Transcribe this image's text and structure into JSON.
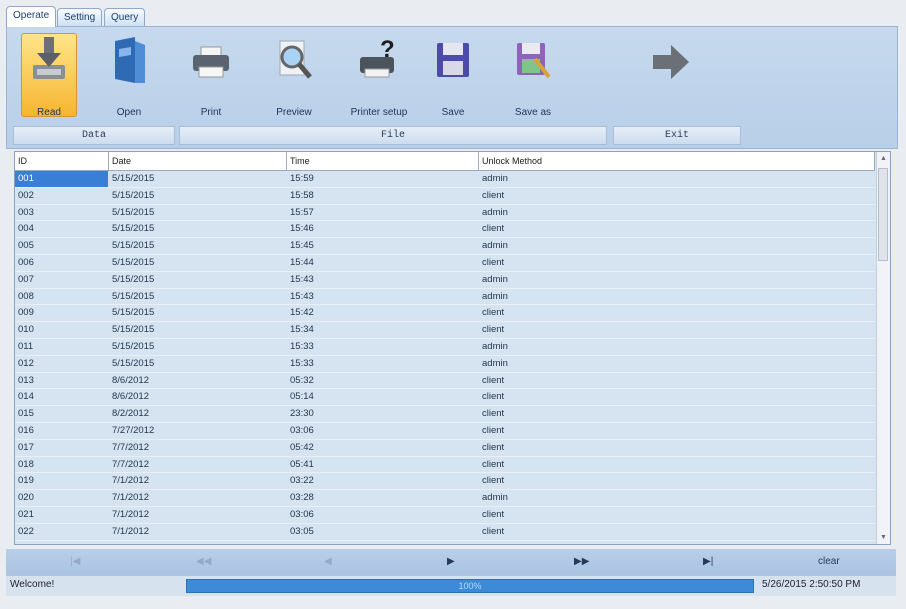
{
  "tabs": [
    "Operate",
    "Setting",
    "Query"
  ],
  "toolbar": {
    "buttons": [
      {
        "label": "Read",
        "icon": "download-icon"
      },
      {
        "label": "Open",
        "icon": "folder-open-icon"
      },
      {
        "label": "Print",
        "icon": "printer-icon"
      },
      {
        "label": "Preview",
        "icon": "magnifier-icon"
      },
      {
        "label": "Printer setup",
        "icon": "printer-setup-icon"
      },
      {
        "label": "Save",
        "icon": "floppy-icon"
      },
      {
        "label": "Save as",
        "icon": "save-as-icon"
      },
      {
        "label": "",
        "icon": "exit-arrow-icon"
      }
    ],
    "groups": [
      "Data",
      "File",
      "Exit"
    ]
  },
  "table": {
    "columns": [
      "ID",
      "Date",
      "Time",
      "Unlock Method"
    ],
    "rows": [
      [
        "001",
        "5/15/2015",
        "15:59",
        "admin"
      ],
      [
        "002",
        "5/15/2015",
        "15:58",
        "client"
      ],
      [
        "003",
        "5/15/2015",
        "15:57",
        "admin"
      ],
      [
        "004",
        "5/15/2015",
        "15:46",
        "client"
      ],
      [
        "005",
        "5/15/2015",
        "15:45",
        "admin"
      ],
      [
        "006",
        "5/15/2015",
        "15:44",
        "client"
      ],
      [
        "007",
        "5/15/2015",
        "15:43",
        "admin"
      ],
      [
        "008",
        "5/15/2015",
        "15:43",
        "admin"
      ],
      [
        "009",
        "5/15/2015",
        "15:42",
        "client"
      ],
      [
        "010",
        "5/15/2015",
        "15:34",
        "client"
      ],
      [
        "011",
        "5/15/2015",
        "15:33",
        "admin"
      ],
      [
        "012",
        "5/15/2015",
        "15:33",
        "admin"
      ],
      [
        "013",
        "8/6/2012",
        "05:32",
        "client"
      ],
      [
        "014",
        "8/6/2012",
        "05:14",
        "client"
      ],
      [
        "015",
        "8/2/2012",
        "23:30",
        "client"
      ],
      [
        "016",
        "7/27/2012",
        "03:06",
        "client"
      ],
      [
        "017",
        "7/7/2012",
        "05:42",
        "client"
      ],
      [
        "018",
        "7/7/2012",
        "05:41",
        "client"
      ],
      [
        "019",
        "7/1/2012",
        "03:22",
        "client"
      ],
      [
        "020",
        "7/1/2012",
        "03:28",
        "admin"
      ],
      [
        "021",
        "7/1/2012",
        "03:06",
        "client"
      ],
      [
        "022",
        "7/1/2012",
        "03:05",
        "client"
      ]
    ]
  },
  "nav": {
    "first": "|◀",
    "prev_page": "◀◀",
    "prev": "◀",
    "next": "▶",
    "next_page": "▶▶",
    "last": "▶|",
    "clear": "clear"
  },
  "status": {
    "welcome": "Welcome!",
    "progress": 1.0,
    "progress_text": "100%",
    "datetime": "5/26/2015 2:50:50 PM"
  },
  "colors": {
    "panel": "#c1d6ec",
    "selection": "#3a7fd6",
    "progress": "#3c8ad8"
  }
}
